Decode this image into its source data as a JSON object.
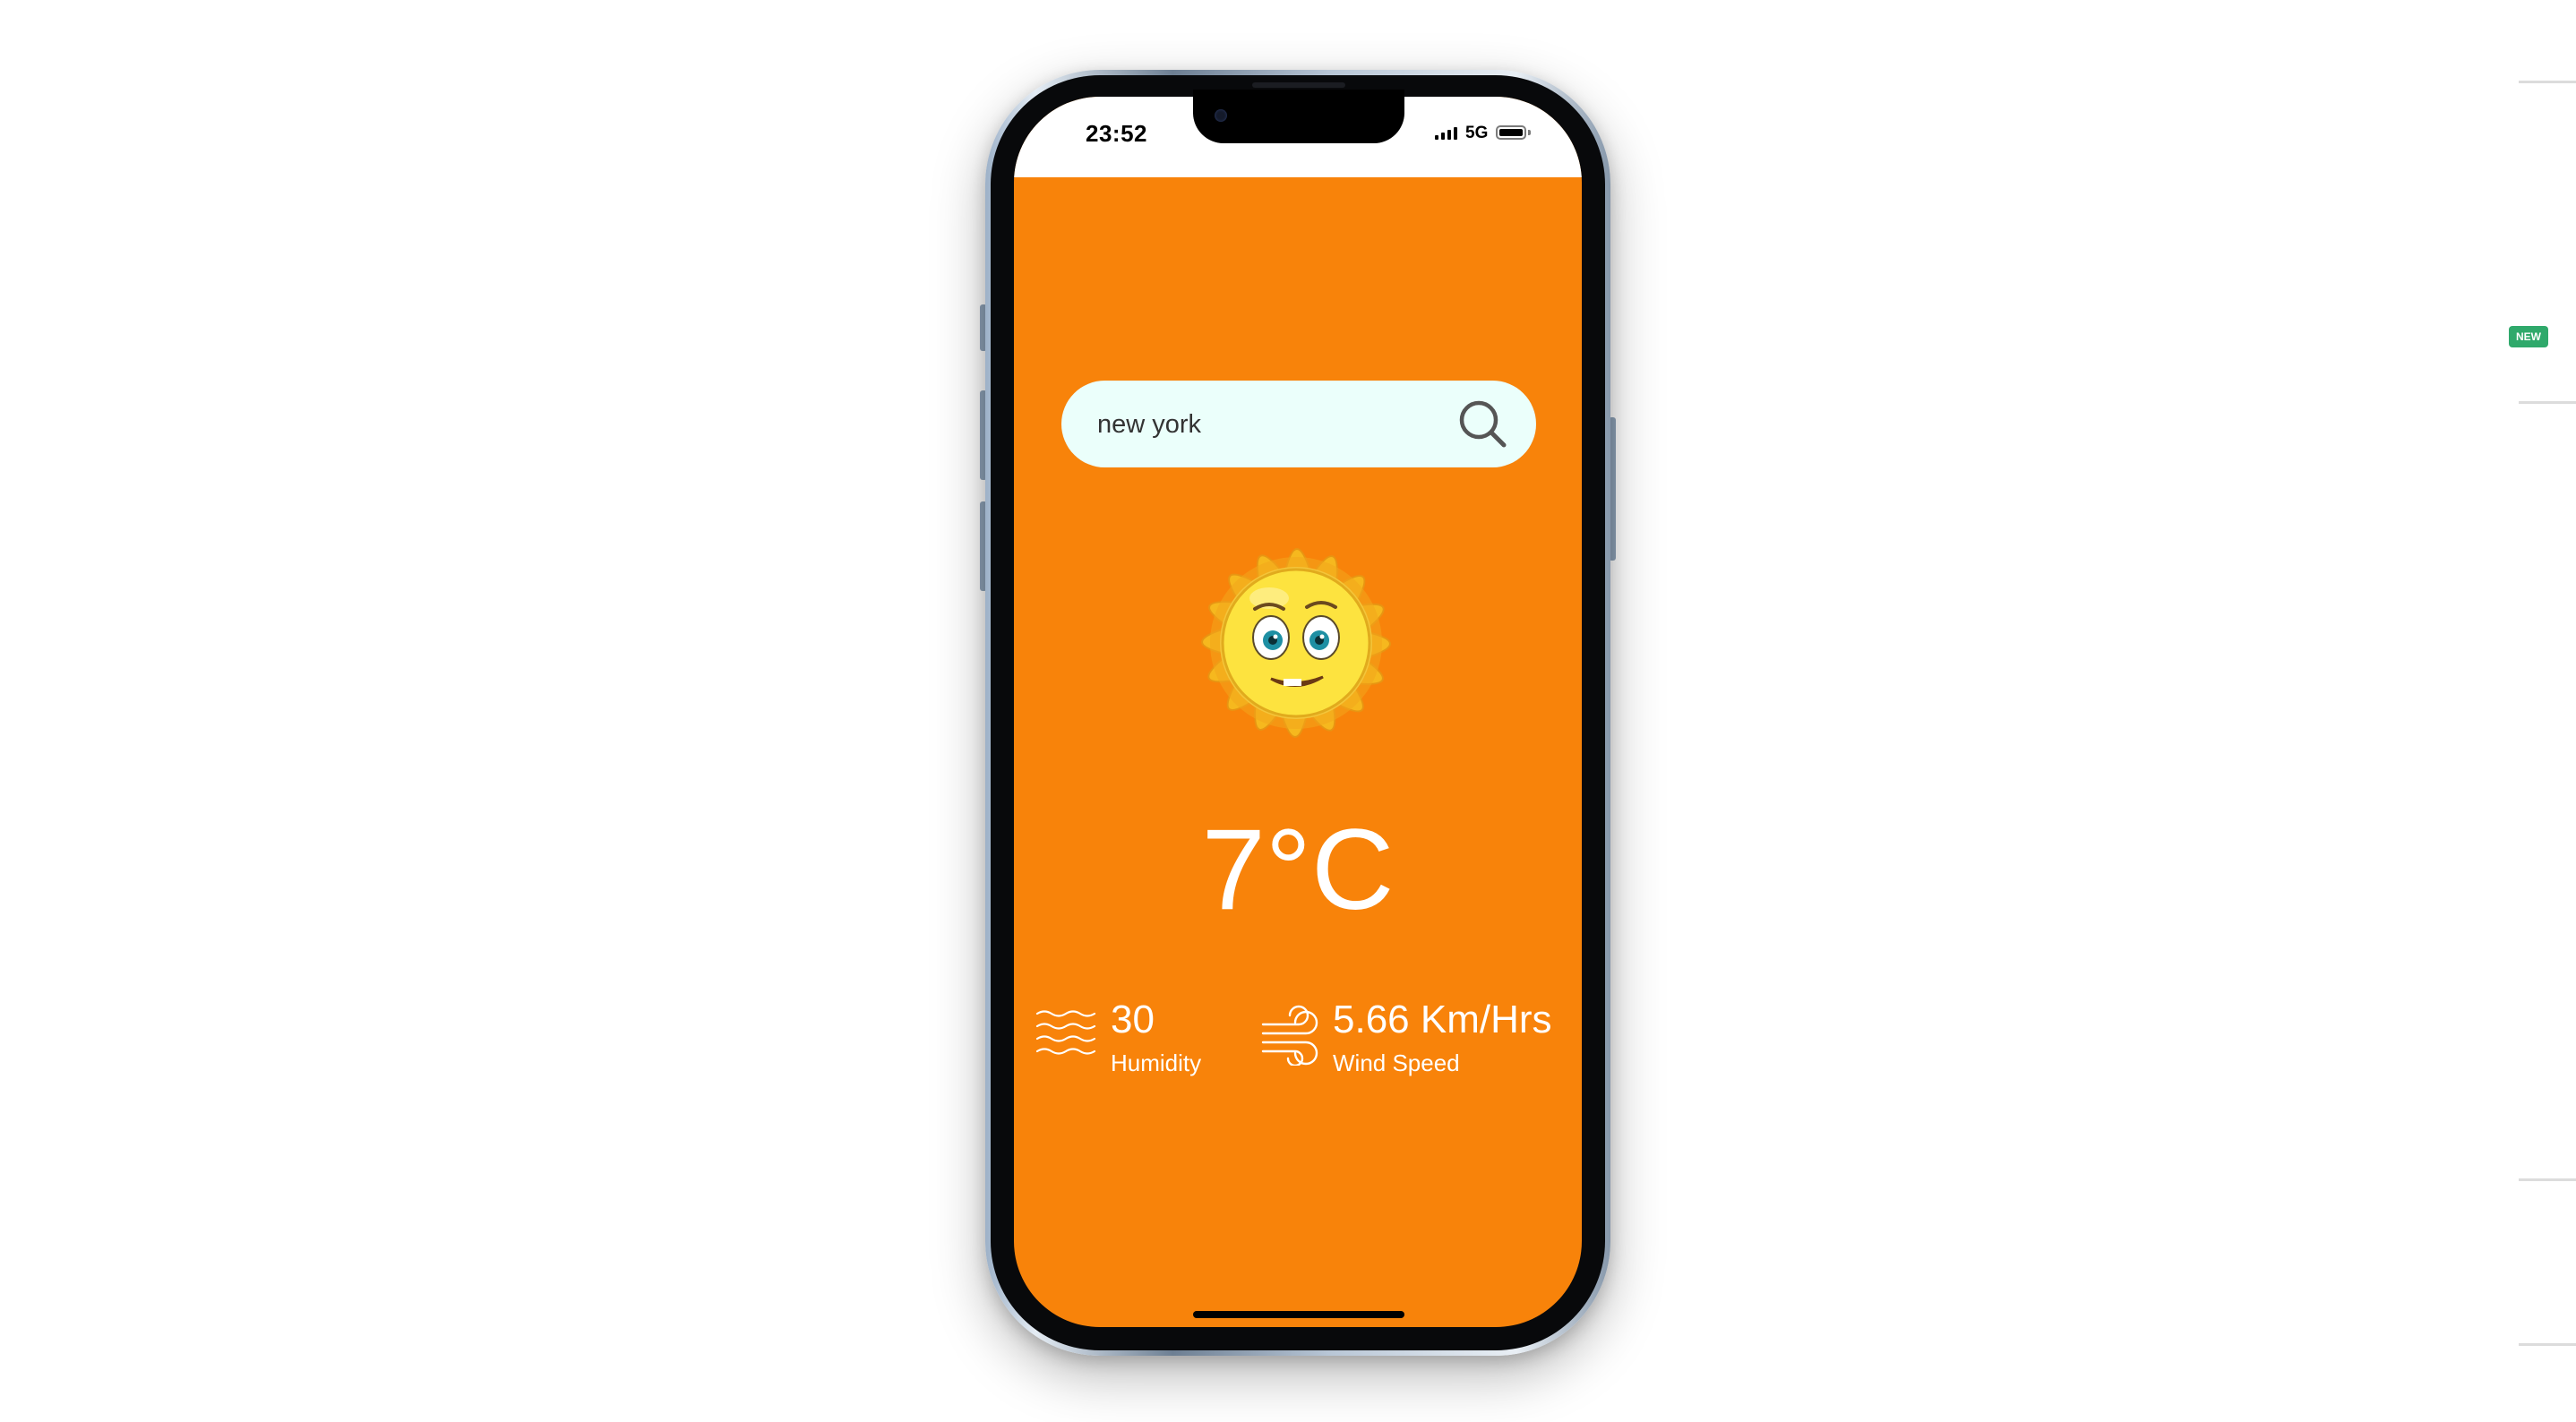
{
  "status_bar": {
    "time": "23:52",
    "network": "5G"
  },
  "sidebar_badge": "NEW",
  "search": {
    "value": "new york",
    "placeholder": "",
    "icon": "search-icon"
  },
  "weather": {
    "icon": "sun-emoji-icon",
    "temperature": "7°C"
  },
  "humidity": {
    "value": "30",
    "label": "Humidity",
    "icon": "humidity-icon"
  },
  "wind": {
    "value": "5.66 Km/Hrs",
    "label": "Wind Speed",
    "icon": "wind-icon"
  },
  "colors": {
    "background": "#f8830a",
    "search_bg": "#ebfffb",
    "text": "#ffffff",
    "badge": "#2fa96b"
  }
}
